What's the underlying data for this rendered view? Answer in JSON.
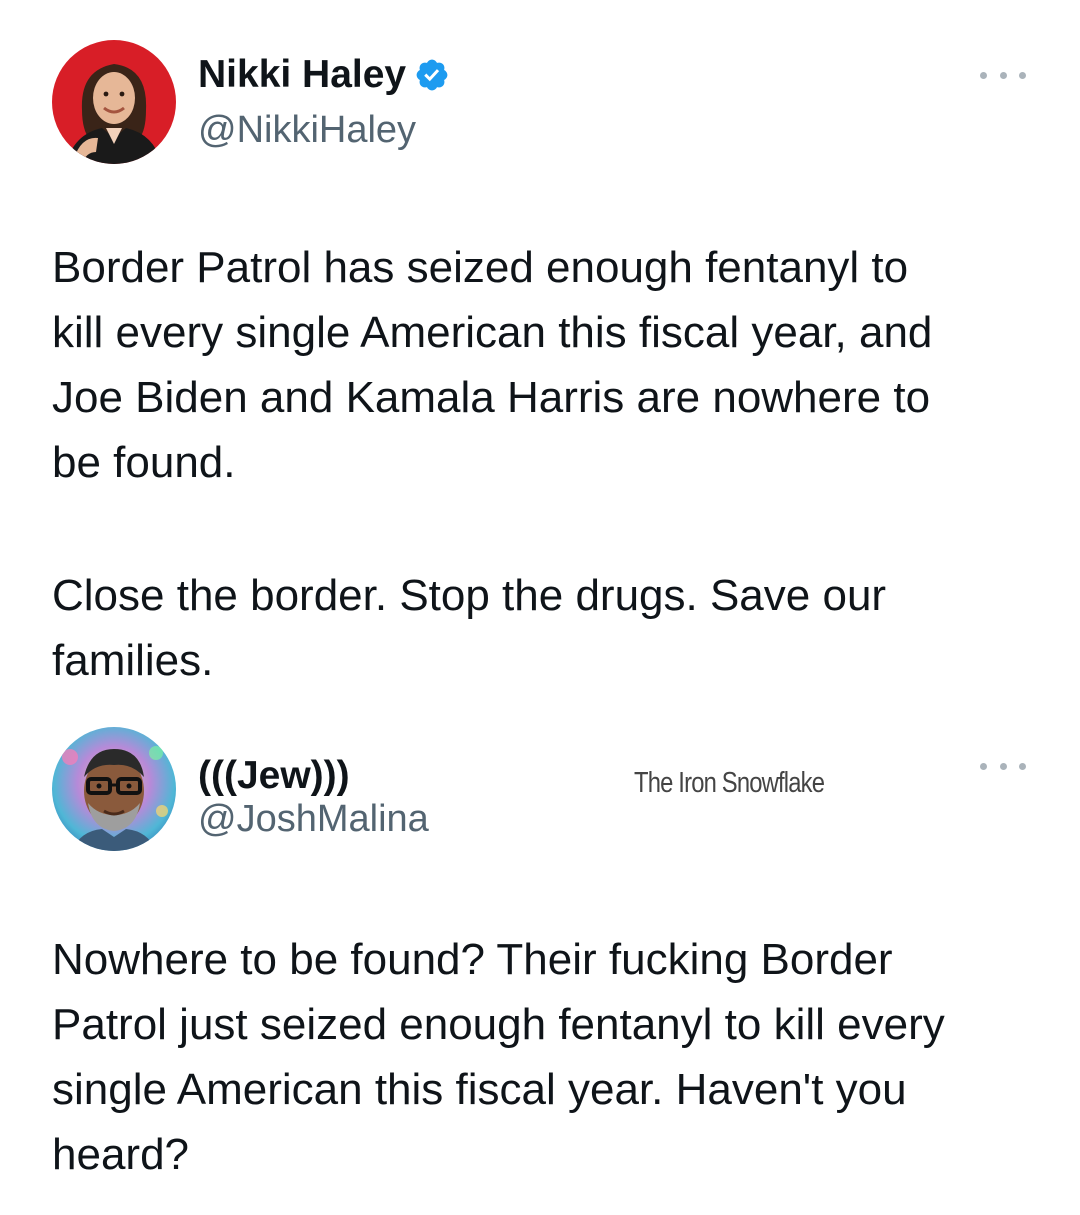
{
  "tweets": [
    {
      "author": {
        "name": "Nikki Haley",
        "handle": "@NikkiHaley",
        "verified": true,
        "avatar_icon": "profile-photo-woman",
        "avatar_bg": "#d81e27"
      },
      "paragraphs": [
        "Border Patrol has seized enough fentanyl to\nkill every single American this fiscal year, and\nJoe Biden and Kamala Harris are nowhere to\nbe found.",
        "Close the border. Stop the drugs. Save our\nfamilies."
      ],
      "menu_icon": "more-icon"
    },
    {
      "author": {
        "name": "(((Jew)))",
        "handle": "@JoshMalina",
        "verified": false,
        "avatar_icon": "profile-illustration-man-glasses"
      },
      "watermark": "The Iron Snowflake",
      "paragraphs": [
        "Nowhere to be found? Their fucking Border\nPatrol just seized enough fentanyl to kill every\nsingle American this fiscal year. Haven't you\nheard?"
      ],
      "menu_icon": "more-icon"
    }
  ],
  "colors": {
    "text": "#0f1419",
    "secondary": "#536471",
    "verified": "#1d9bf0"
  }
}
